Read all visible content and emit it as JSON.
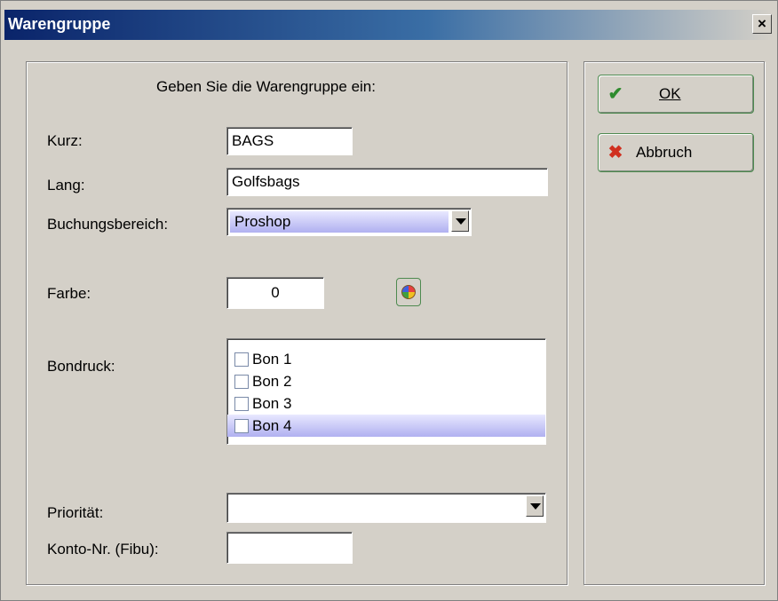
{
  "window": {
    "title": "Warengruppe",
    "close_label": "×"
  },
  "form": {
    "heading": "Geben Sie die Warengruppe ein:",
    "kurz_label": "Kurz:",
    "kurz_value": "BAGS",
    "lang_label": "Lang:",
    "lang_value": "Golfsbags",
    "buchungsbereich_label": "Buchungsbereich:",
    "buchungsbereich_value": "Proshop",
    "farbe_label": "Farbe:",
    "farbe_value": "0",
    "bondruck_label": "Bondruck:",
    "bondruck_items": [
      "Bon 1",
      "Bon 2",
      "Bon 3",
      "Bon 4"
    ],
    "prioritaet_label": "Priorität:",
    "prioritaet_value": "",
    "konto_label": "Konto-Nr. (Fibu):",
    "konto_value": ""
  },
  "buttons": {
    "ok_label": "OK",
    "abbruch_label": "Abbruch"
  },
  "icons": {
    "ok": "check-icon",
    "abbruch": "cross-icon",
    "farbe": "palette-icon",
    "combo": "chevron-down-icon"
  },
  "colors": {
    "ok_icon": "#2e8b2e",
    "abbruch_icon": "#d03020",
    "selection": "#b0b0f0"
  }
}
